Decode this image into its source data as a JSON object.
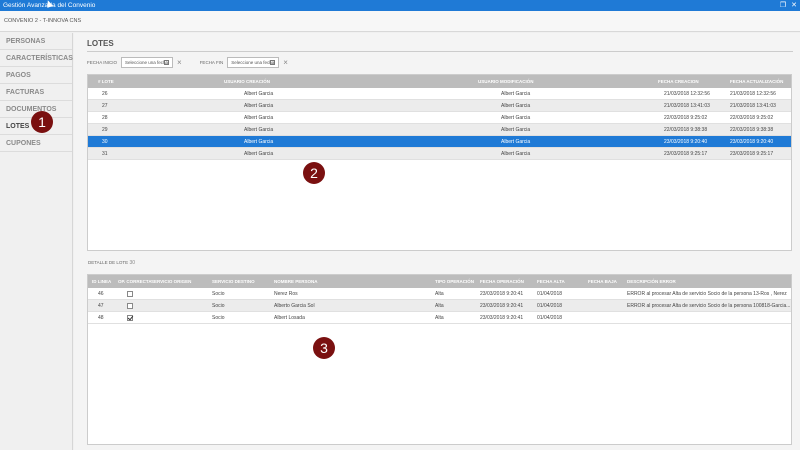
{
  "window": {
    "title": "Gestión Avanzada del Convenio"
  },
  "header": {
    "breadcrumb": "CONVENIO 2 - T-INNOVA CNS"
  },
  "sidebar": {
    "items": [
      {
        "label": "PERSONAS"
      },
      {
        "label": "CARACTERÍSTICAS"
      },
      {
        "label": "PAGOS"
      },
      {
        "label": "FACTURAS"
      },
      {
        "label": "DOCUMENTOS"
      },
      {
        "label": "LOTES"
      },
      {
        "label": "CUPONES"
      }
    ]
  },
  "main": {
    "title": "LOTES",
    "filters": {
      "start_label": "FECHA INICIO",
      "start_placeholder": "Seleccione una fecha",
      "end_label": "FECHA FIN",
      "end_placeholder": "Seleccione una fecha"
    },
    "lotes": {
      "columns": [
        "# LOTE",
        "USUARIO CREACIÓN",
        "USUARIO MODIFICACIÓN",
        "FECHA CREACION",
        "FECHA ACTUALIZACIÓN"
      ],
      "rows": [
        {
          "lote": "26",
          "creacion": "Albert Garcia",
          "modificacion": "Albert Garcia",
          "fecha_creacion": "21/03/2018 12:32:56",
          "fecha_actualizacion": "21/03/2018 12:32:56"
        },
        {
          "lote": "27",
          "creacion": "Albert Garcia",
          "modificacion": "Albert Garcia",
          "fecha_creacion": "21/03/2018 13:41:03",
          "fecha_actualizacion": "21/03/2018 13:41:03"
        },
        {
          "lote": "28",
          "creacion": "Albert Garcia",
          "modificacion": "Albert Garcia",
          "fecha_creacion": "22/03/2018 9:25:02",
          "fecha_actualizacion": "22/03/2018 9:25:02"
        },
        {
          "lote": "29",
          "creacion": "Albert Garcia",
          "modificacion": "Albert Garcia",
          "fecha_creacion": "22/03/2018 9:38:38",
          "fecha_actualizacion": "22/03/2018 9:38:38"
        },
        {
          "lote": "30",
          "creacion": "Albert Garcia",
          "modificacion": "Albert Garcia",
          "fecha_creacion": "23/03/2018 9:20:40",
          "fecha_actualizacion": "23/03/2018 9:20:40"
        },
        {
          "lote": "31",
          "creacion": "Albert Garcia",
          "modificacion": "Albert Garcia",
          "fecha_creacion": "23/03/2018 9:25:17",
          "fecha_actualizacion": "23/03/2018 9:25:17"
        }
      ],
      "selected_index": 4
    },
    "detalle": {
      "label": "DETALLE DE LOTE",
      "lote": "30",
      "columns": [
        "ID LINEA",
        "OP. CORRECTA",
        "SERVICIO ORIGEN",
        "SERVICIO DESTINO",
        "NOMBRE PERSONA",
        "TIPO OPERACIÓN",
        "FECHA OPERACIÓN",
        "FECHA ALTA",
        "FECHA BAJA",
        "DESCRIPCIÓN ERROR"
      ],
      "rows": [
        {
          "id": "46",
          "correcta": false,
          "origen": "",
          "destino": "Socio",
          "persona": "Nerez Ros",
          "tipo": "Alta",
          "fecha_op": "23/03/2018 9:20:41",
          "alta": "01/04/2018",
          "baja": "",
          "error": "ERROR al procesar Alta de servicio Socio de la persona 13-Ros , Nerez"
        },
        {
          "id": "47",
          "correcta": false,
          "origen": "",
          "destino": "Socio",
          "persona": "Alberto Garcia Sol",
          "tipo": "Alta",
          "fecha_op": "23/03/2018 9:20:41",
          "alta": "01/04/2018",
          "baja": "",
          "error": "ERROR al procesar Alta de servicio Socio de la persona 100818-Garcia..."
        },
        {
          "id": "48",
          "correcta": true,
          "origen": "",
          "destino": "Socio",
          "persona": "Albert Losada",
          "tipo": "Alta",
          "fecha_op": "23/03/2018 9:20:41",
          "alta": "01/04/2018",
          "baja": "",
          "error": ""
        }
      ]
    }
  },
  "callouts": [
    "1",
    "2",
    "3"
  ],
  "colors": {
    "titlebar": "#1f7ad6",
    "selected_row": "#1f7ad6",
    "grid_header": "#bcbcbc",
    "callout": "#7a1010"
  }
}
